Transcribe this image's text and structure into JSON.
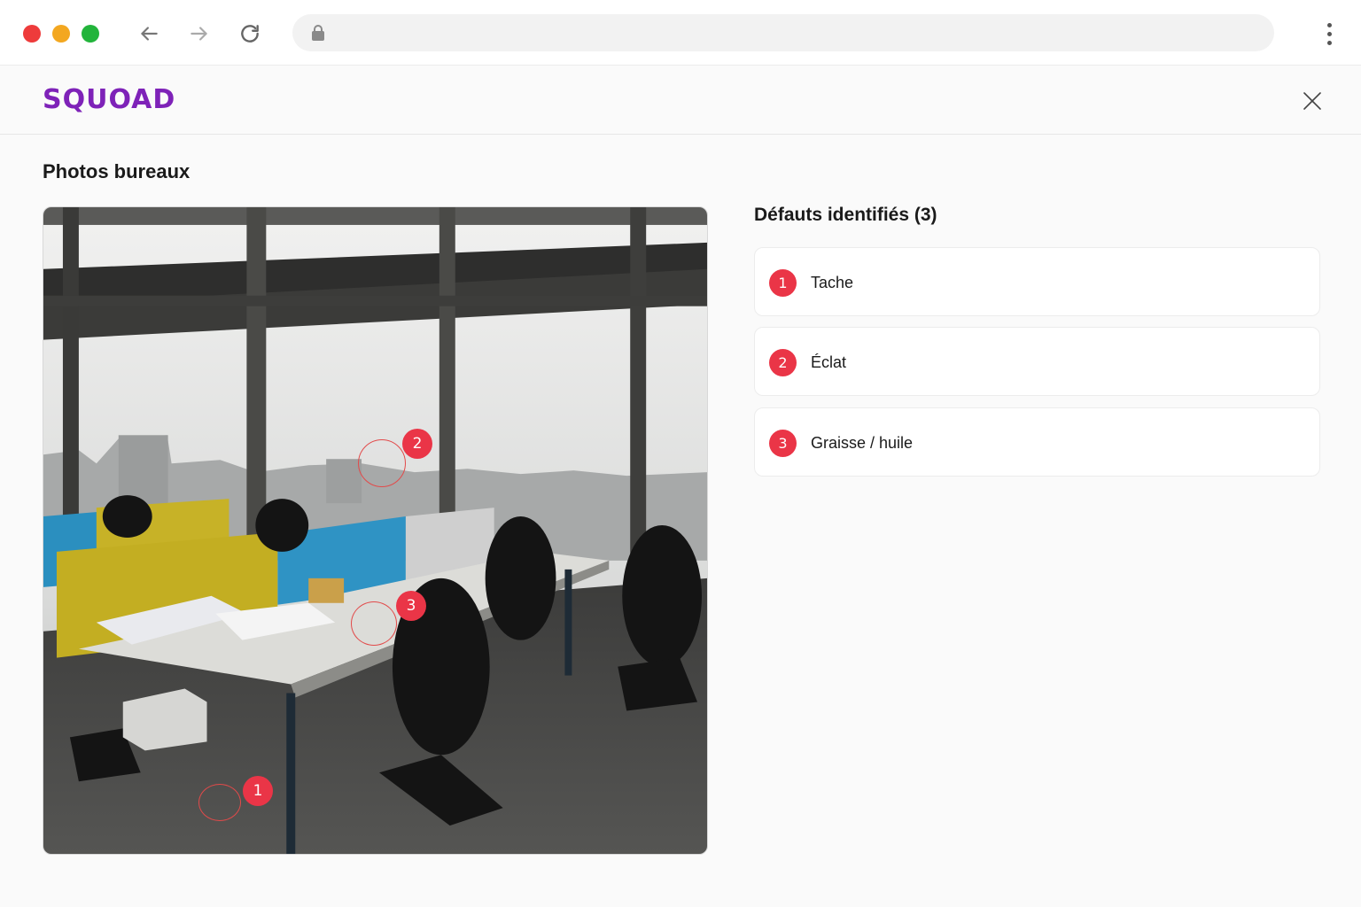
{
  "browser": {
    "icons": [
      "back-arrow-icon",
      "forward-arrow-icon",
      "reload-icon",
      "lock-icon",
      "kebab-menu-icon"
    ],
    "dot_colors": [
      "#ee3b3b",
      "#f3a720",
      "#22b43b"
    ]
  },
  "app": {
    "logo": "SQUOAD",
    "brand_color": "#7e22b8",
    "close_icon": "close-icon"
  },
  "photos": {
    "title": "Photos bureaux",
    "markers": [
      {
        "number": "1"
      },
      {
        "number": "2"
      },
      {
        "number": "3"
      }
    ]
  },
  "defects": {
    "title": "Défauts identifiés (3)",
    "accent_color": "#ea3547",
    "items": [
      {
        "number": "1",
        "label": "Tache"
      },
      {
        "number": "2",
        "label": "Éclat"
      },
      {
        "number": "3",
        "label": "Graisse / huile"
      }
    ]
  }
}
